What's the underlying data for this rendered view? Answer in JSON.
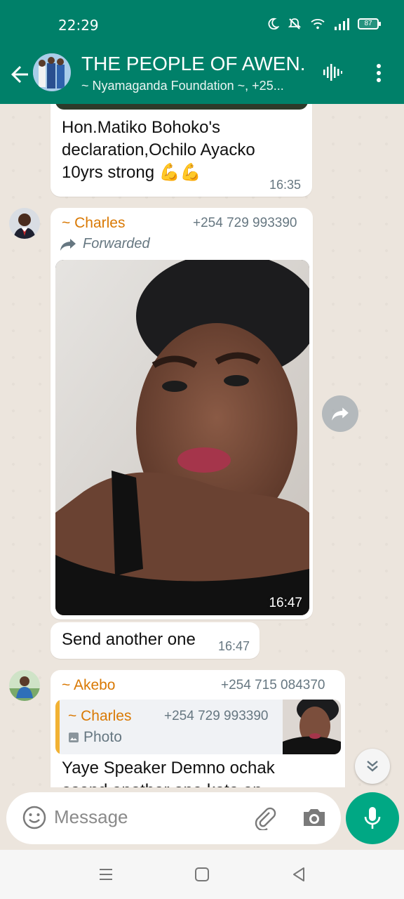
{
  "status_bar": {
    "time": "22:29",
    "battery": "87"
  },
  "header": {
    "title": "THE PEOPLE OF AWEN...",
    "subtitle": "~ Nyamaganda Foundation ~, +25..."
  },
  "messages": [
    {
      "text_lines": [
        "Hon.Matiko Bohoko's",
        "declaration,Ochilo Ayacko",
        "10yrs strong 💪💪"
      ],
      "time": "16:35"
    },
    {
      "sender": "~ Charles",
      "phone": "+254 729 993390",
      "forwarded_label": "Forwarded",
      "time": "16:47"
    },
    {
      "text": "Send another one",
      "time": "16:47"
    },
    {
      "sender": "~ Akebo",
      "phone": "+254 715 084370",
      "quote": {
        "sender": "~ Charles",
        "phone": "+254 729 993390",
        "type_label": "Photo"
      },
      "text_lines": [
        "Yaye Speaker Demno ochak",
        "osend another one kata an"
      ]
    }
  ],
  "composer": {
    "placeholder": "Message"
  },
  "colors": {
    "header": "#008069",
    "accent": "#00a884",
    "sender": "#d97904",
    "quote_bar": "#f2b233"
  },
  "icons": [
    "back-arrow-icon",
    "voice-call-icon",
    "more-vert-icon",
    "forward-arrow-icon",
    "scroll-down-icon",
    "emoji-icon",
    "attach-icon",
    "camera-icon",
    "mic-icon",
    "recents-icon",
    "home-icon",
    "back-nav-icon"
  ]
}
